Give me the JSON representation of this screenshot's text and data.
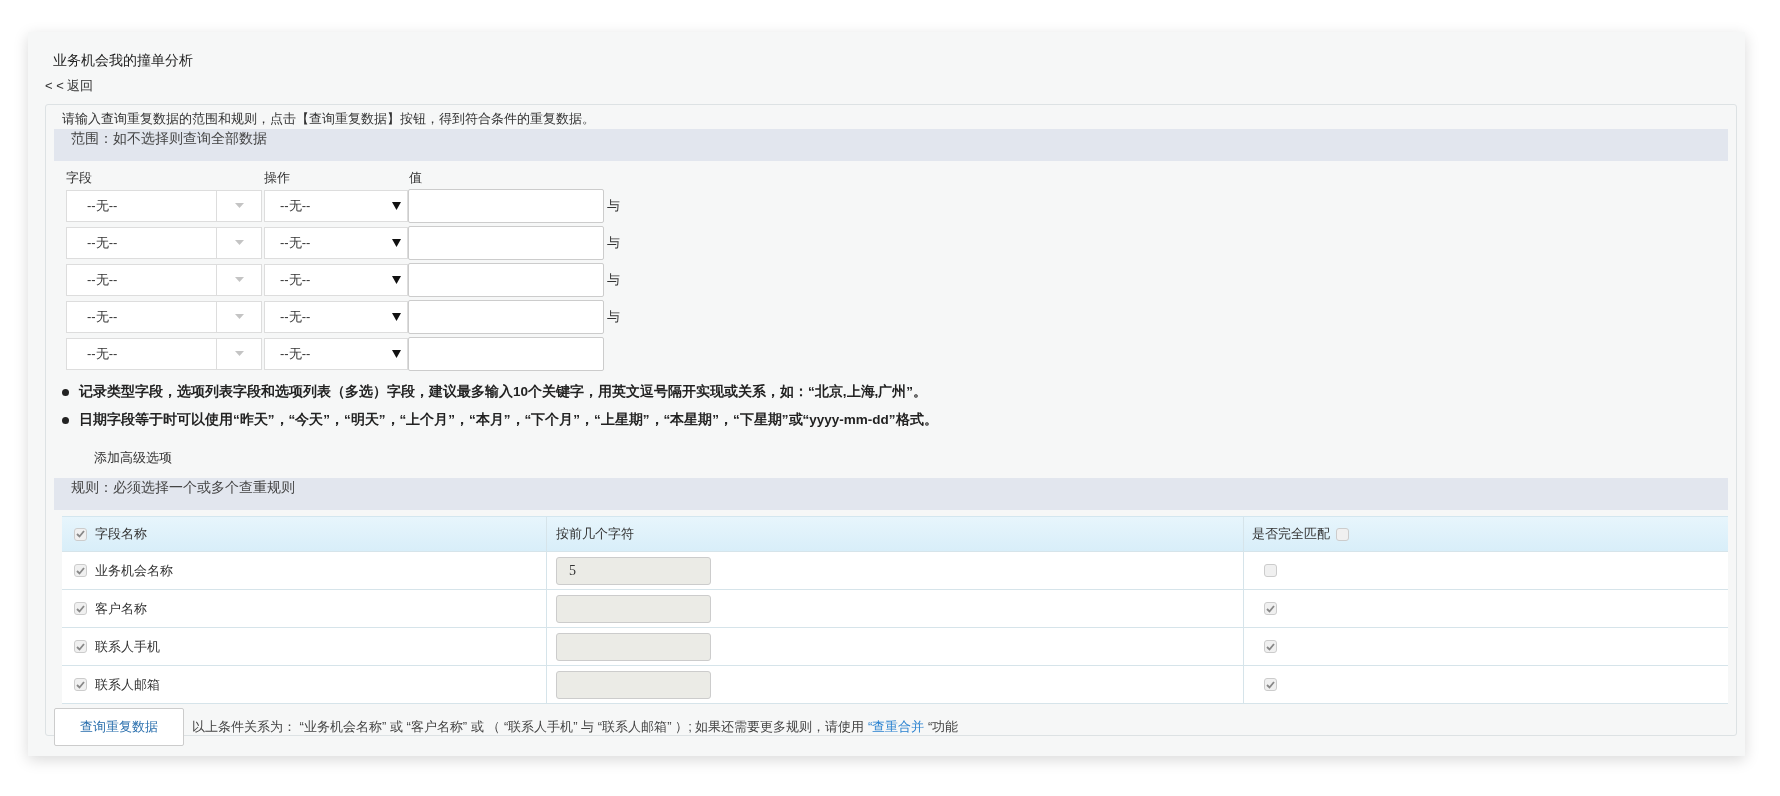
{
  "title": "业务机会我的撞单分析",
  "back_link": "< < 返回",
  "intro": "请输入查询重复数据的范围和规则，点击【查询重复数据】按钮，得到符合条件的重复数据。",
  "scope_section": {
    "title": "范围：如不选择则查询全部数据",
    "columns": [
      "字段",
      "操作",
      "值"
    ],
    "rows": [
      {
        "field": "--无--",
        "operator": "--无--",
        "connector": "与"
      },
      {
        "field": "--无--",
        "operator": "--无--",
        "connector": "与"
      },
      {
        "field": "--无--",
        "operator": "--无--",
        "connector": "与"
      },
      {
        "field": "--无--",
        "operator": "--无--",
        "connector": "与"
      },
      {
        "field": "--无--",
        "operator": "--无--"
      }
    ]
  },
  "notes": [
    "记录类型字段，选项列表字段和选项列表（多选）字段，建议最多输入10个关键字，用英文逗号隔开实现或关系，如：“北京,上海,广州”。",
    "日期字段等于时可以使用“昨天”，“今天”，“明天”，“上个月”，“本月”，“下个月”，“上星期”，“本星期”，“下星期”或“yyyy-mm-dd”格式。"
  ],
  "advanced_link": "添加高级选项",
  "rules_section": {
    "title": "规则：必须选择一个或多个查重规则",
    "header": {
      "field_name": "字段名称",
      "all_checked": true,
      "prefix_chars": "按前几个字符",
      "exact_match": "是否完全匹配",
      "all_exact": false
    },
    "rows": [
      {
        "checked": true,
        "name": "业务机会名称",
        "prefix": "5",
        "exact": false
      },
      {
        "checked": true,
        "name": "客户名称",
        "exact": true
      },
      {
        "checked": true,
        "name": "联系人手机",
        "exact": true
      },
      {
        "checked": true,
        "name": "联系人邮箱",
        "exact": true
      }
    ]
  },
  "query_button": "查询重复数据",
  "summary": {
    "before": "以上条件关系为： “业务机会名称” 或 “客户名称” 或 （ “联系人手机” 与 “联系人邮箱” ）; 如果还需要更多规则，请使用 ",
    "link": "“查重合并",
    "after": " “功能"
  }
}
